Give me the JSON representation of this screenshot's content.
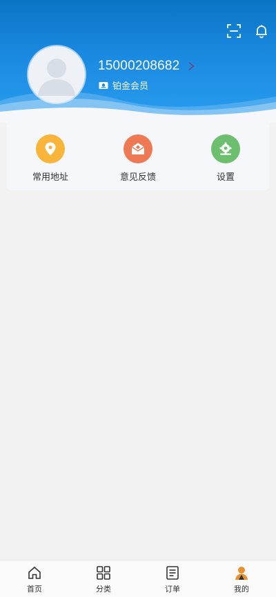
{
  "header": {
    "phone": "15000208682",
    "member_level": "铂金会员",
    "icons": [
      "scan-icon",
      "bell-icon"
    ]
  },
  "quick_actions": [
    {
      "label": "常用地址",
      "icon": "location-pin-icon",
      "color": "#f8b53a"
    },
    {
      "label": "意见反馈",
      "icon": "envelope-icon",
      "color": "#ee7a55"
    },
    {
      "label": "设置",
      "icon": "gear-icon",
      "color": "#6cbf6f"
    }
  ],
  "bottom_nav": [
    {
      "label": "首页",
      "icon": "home-icon"
    },
    {
      "label": "分类",
      "icon": "grid-icon"
    },
    {
      "label": "订单",
      "icon": "list-icon"
    },
    {
      "label": "我的",
      "icon": "user-icon",
      "active": true
    }
  ],
  "colors": {
    "header_blue": "#1a8ae0",
    "background": "#f2f2f2",
    "active_nav": "#e8912e"
  }
}
